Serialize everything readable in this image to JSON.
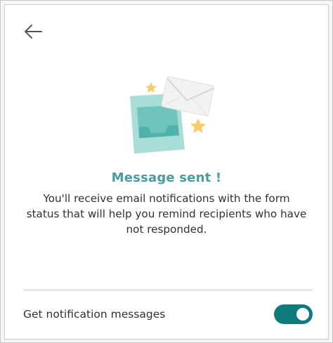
{
  "dialog": {
    "title": "Message sent !",
    "message": "You'll receive email notifications with the form status that will help you remind recipients who have not responded."
  },
  "notification_toggle": {
    "label": "Get notification messages",
    "on": true
  },
  "icons": {
    "back": "arrow-left-icon",
    "illustration": "envelope-inbox-stars-illustration"
  },
  "colors": {
    "accent": "#0f7b7c",
    "title": "#4c9aa1",
    "illustration_teal": "#a9ddd8",
    "star": "#f6cd6d"
  }
}
